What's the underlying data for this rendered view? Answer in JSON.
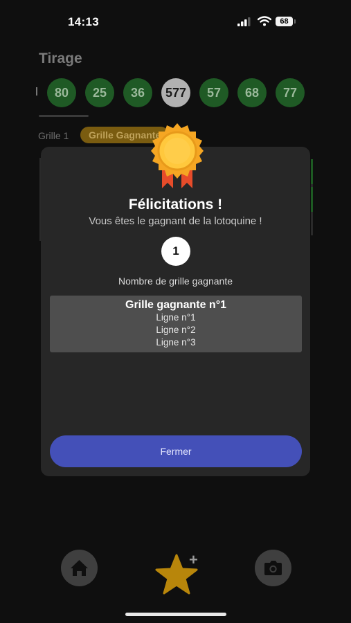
{
  "status": {
    "time": "14:13",
    "battery": "68"
  },
  "header": {
    "title": "Tirage"
  },
  "draw_numbers": [
    {
      "value": "80",
      "state": "green"
    },
    {
      "value": "25",
      "state": "green"
    },
    {
      "value": "36",
      "state": "green"
    },
    {
      "value": "577",
      "state": "grey"
    },
    {
      "value": "57",
      "state": "green"
    },
    {
      "value": "68",
      "state": "green"
    },
    {
      "value": "77",
      "state": "green"
    }
  ],
  "tabs": {
    "grid_label": "Grille 1",
    "badge_label": "Grille Gagnante"
  },
  "modal": {
    "title": "Félicitations !",
    "subtitle": "Vous êtes le gagnant de la lotoquine !",
    "winning_count": "1",
    "count_label": "Nombre de grille gagnante",
    "winning_grid": {
      "title": "Grille gagnante n°1",
      "lines": [
        "Ligne n°1",
        "Ligne n°2",
        "Ligne n°3"
      ]
    },
    "close_label": "Fermer"
  },
  "bottom_nav": {
    "home_icon": "home-icon",
    "star_icon": "star-icon",
    "plus_label": "+",
    "camera_icon": "camera-icon"
  },
  "colors": {
    "accent": "#4450b8",
    "ball_green": "#1f5a25",
    "medal": "#f5a623",
    "ribbon": "#e74c2a",
    "star": "#b8860b"
  }
}
